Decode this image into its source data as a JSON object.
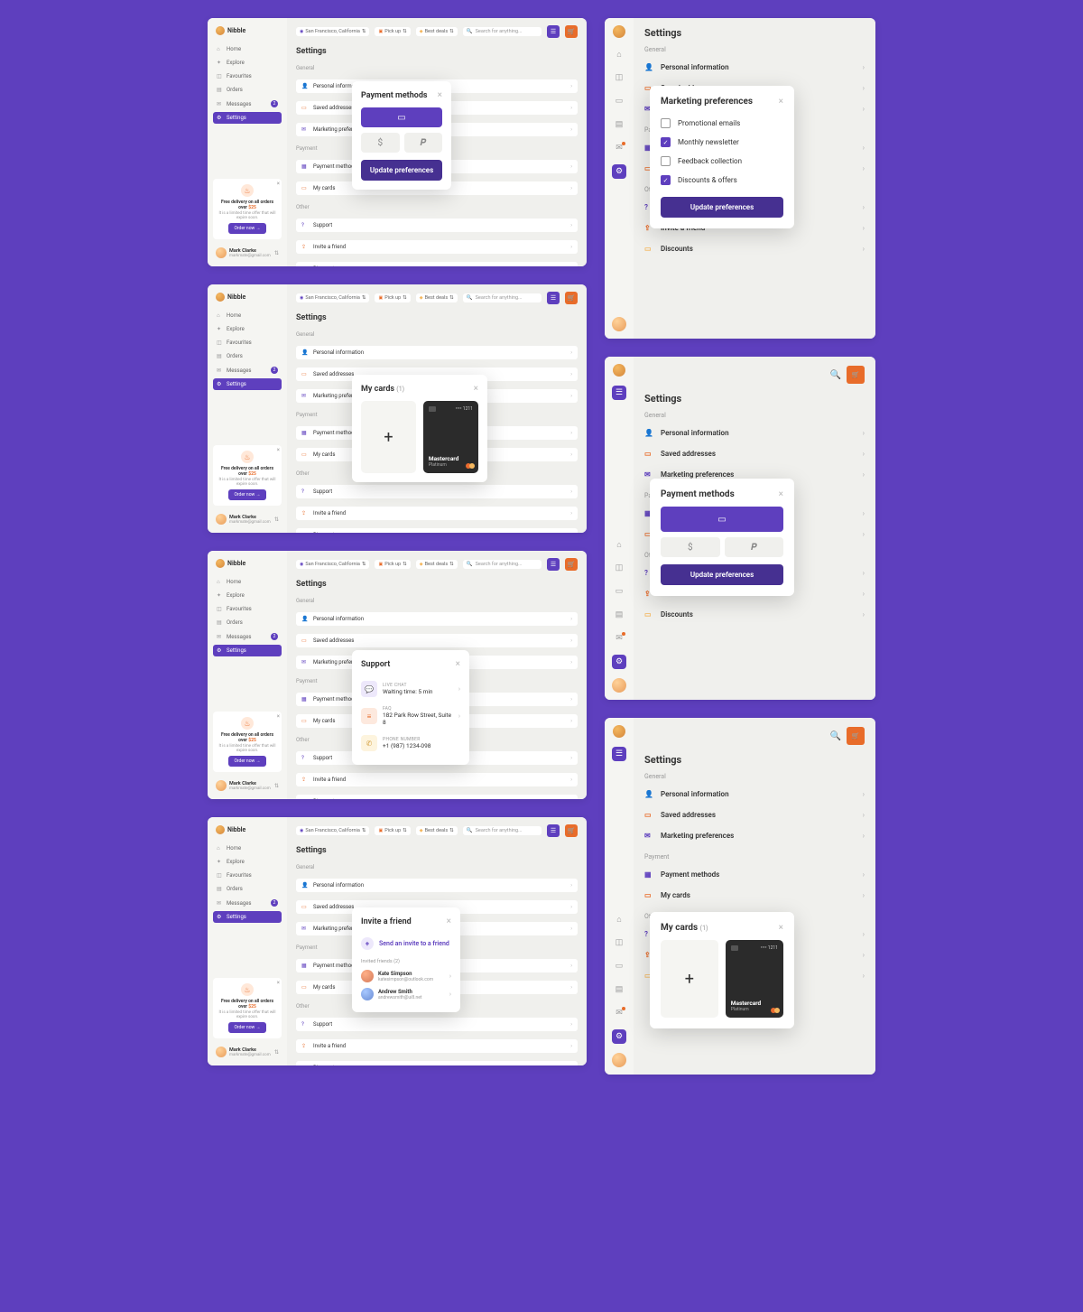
{
  "brand": "Nibble",
  "nav": {
    "home": "Home",
    "explore": "Explore",
    "favourites": "Favourites",
    "orders": "Orders",
    "messages": "Messages",
    "messages_badge": "2",
    "settings": "Settings"
  },
  "promo": {
    "title": "Free delivery on all orders over ",
    "amount": "$25",
    "sub": "It is a limited time offer that will expire soon.",
    "btn": "Order now  →"
  },
  "user": {
    "name": "Mark Clarke",
    "email": "markmate@gmail.com"
  },
  "topbar": {
    "location": "San Francisco, California",
    "pickup": "Pick up",
    "deals": "Best deals",
    "search_placeholder": "Search for anything..."
  },
  "settings": {
    "title": "Settings",
    "general": "General",
    "personal": "Personal information",
    "addresses": "Saved addresses",
    "marketing": "Marketing preferences",
    "paymentSect": "Payment",
    "paymethods": "Payment methods",
    "mycards": "My cards",
    "other": "Other",
    "support": "Support",
    "invite": "Invite a friend",
    "discounts": "Discounts"
  },
  "pop_payment": {
    "title": "Payment methods",
    "update": "Update preferences"
  },
  "pop_marketing": {
    "title": "Marketing preferences",
    "opts": [
      "Promotional emails",
      "Monthly newsletter",
      "Feedback collection",
      "Discounts & offers"
    ],
    "checked": [
      false,
      true,
      false,
      true
    ],
    "update": "Update preferences"
  },
  "pop_cards": {
    "title": "My cards ",
    "count": "(1)",
    "card_num": "•••• 1211",
    "card_name": "Mastercard",
    "card_tier": "Platinum"
  },
  "pop_support": {
    "title": "Support",
    "chat_label": "LIVE CHAT",
    "chat_val": "Waiting time: 5 min",
    "faq_label": "FAQ",
    "faq_val": "182 Park Row Street, Suite 8",
    "phone_label": "PHONE NUMBER",
    "phone_val": "+1 (987) 1234-098"
  },
  "pop_invite": {
    "title": "Invite a friend",
    "btn": "Send an invite to a friend",
    "sect": "Invited friends (2)",
    "f1_name": "Kate Simpson",
    "f1_email": "katesimpson@outlook.com",
    "f2_name": "Andrew Smith",
    "f2_email": "andrewsmith@ui8.net"
  }
}
